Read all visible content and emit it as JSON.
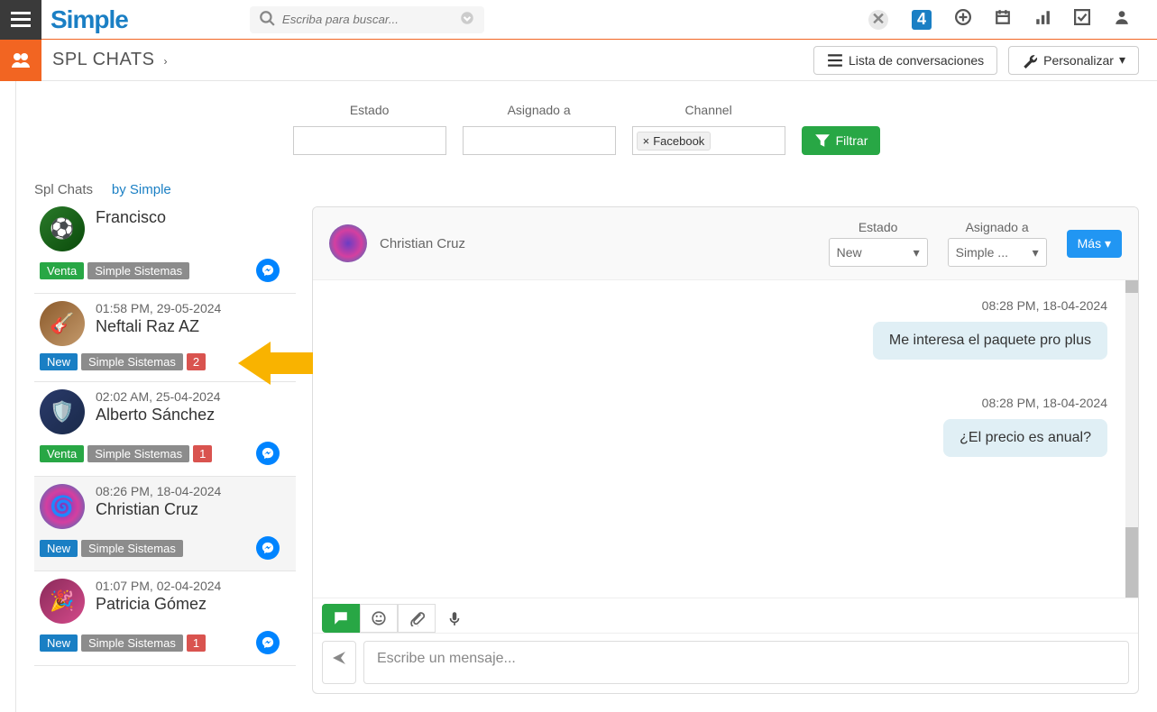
{
  "header": {
    "logo_text": "Simple",
    "search_placeholder": "Escriba para buscar...",
    "icon_box_text": "4"
  },
  "subheader": {
    "title": "SPL CHATS",
    "conversations_btn": "Lista de conversaciones",
    "customize_btn": "Personalizar"
  },
  "filters": {
    "estado_label": "Estado",
    "asignado_label": "Asignado a",
    "channel_label": "Channel",
    "channel_tag": "Facebook",
    "filter_btn": "Filtrar"
  },
  "breadcrumb": {
    "module": "Spl Chats",
    "by": "by Simple"
  },
  "chat_list": [
    {
      "name": "Francisco",
      "time": "",
      "status": "Venta",
      "team": "Simple Sistemas",
      "unread": null,
      "active": false
    },
    {
      "name": "Neftali Raz AZ",
      "time": "01:58 PM, 29-05-2024",
      "status": "New",
      "team": "Simple Sistemas",
      "unread": "2",
      "active": false,
      "highlight_arrow": true
    },
    {
      "name": "Alberto Sánchez",
      "time": "02:02 AM, 25-04-2024",
      "status": "Venta",
      "team": "Simple Sistemas",
      "unread": "1",
      "active": false
    },
    {
      "name": "Christian Cruz",
      "time": "08:26 PM, 18-04-2024",
      "status": "New",
      "team": "Simple Sistemas",
      "unread": null,
      "active": true
    },
    {
      "name": "Patricia Gómez",
      "time": "01:07 PM, 02-04-2024",
      "status": "New",
      "team": "Simple Sistemas",
      "unread": "1",
      "active": false
    }
  ],
  "detail": {
    "contact_name": "Christian Cruz",
    "estado_label": "Estado",
    "estado_value": "New",
    "asignado_label": "Asignado a",
    "asignado_value": "Simple ...",
    "more_btn": "Más"
  },
  "messages": [
    {
      "time": "08:28 PM, 18-04-2024",
      "text": "Me interesa el paquete pro plus"
    },
    {
      "time": "08:28 PM, 18-04-2024",
      "text": "¿El precio es anual?"
    }
  ],
  "composer": {
    "placeholder": "Escribe un mensaje..."
  }
}
